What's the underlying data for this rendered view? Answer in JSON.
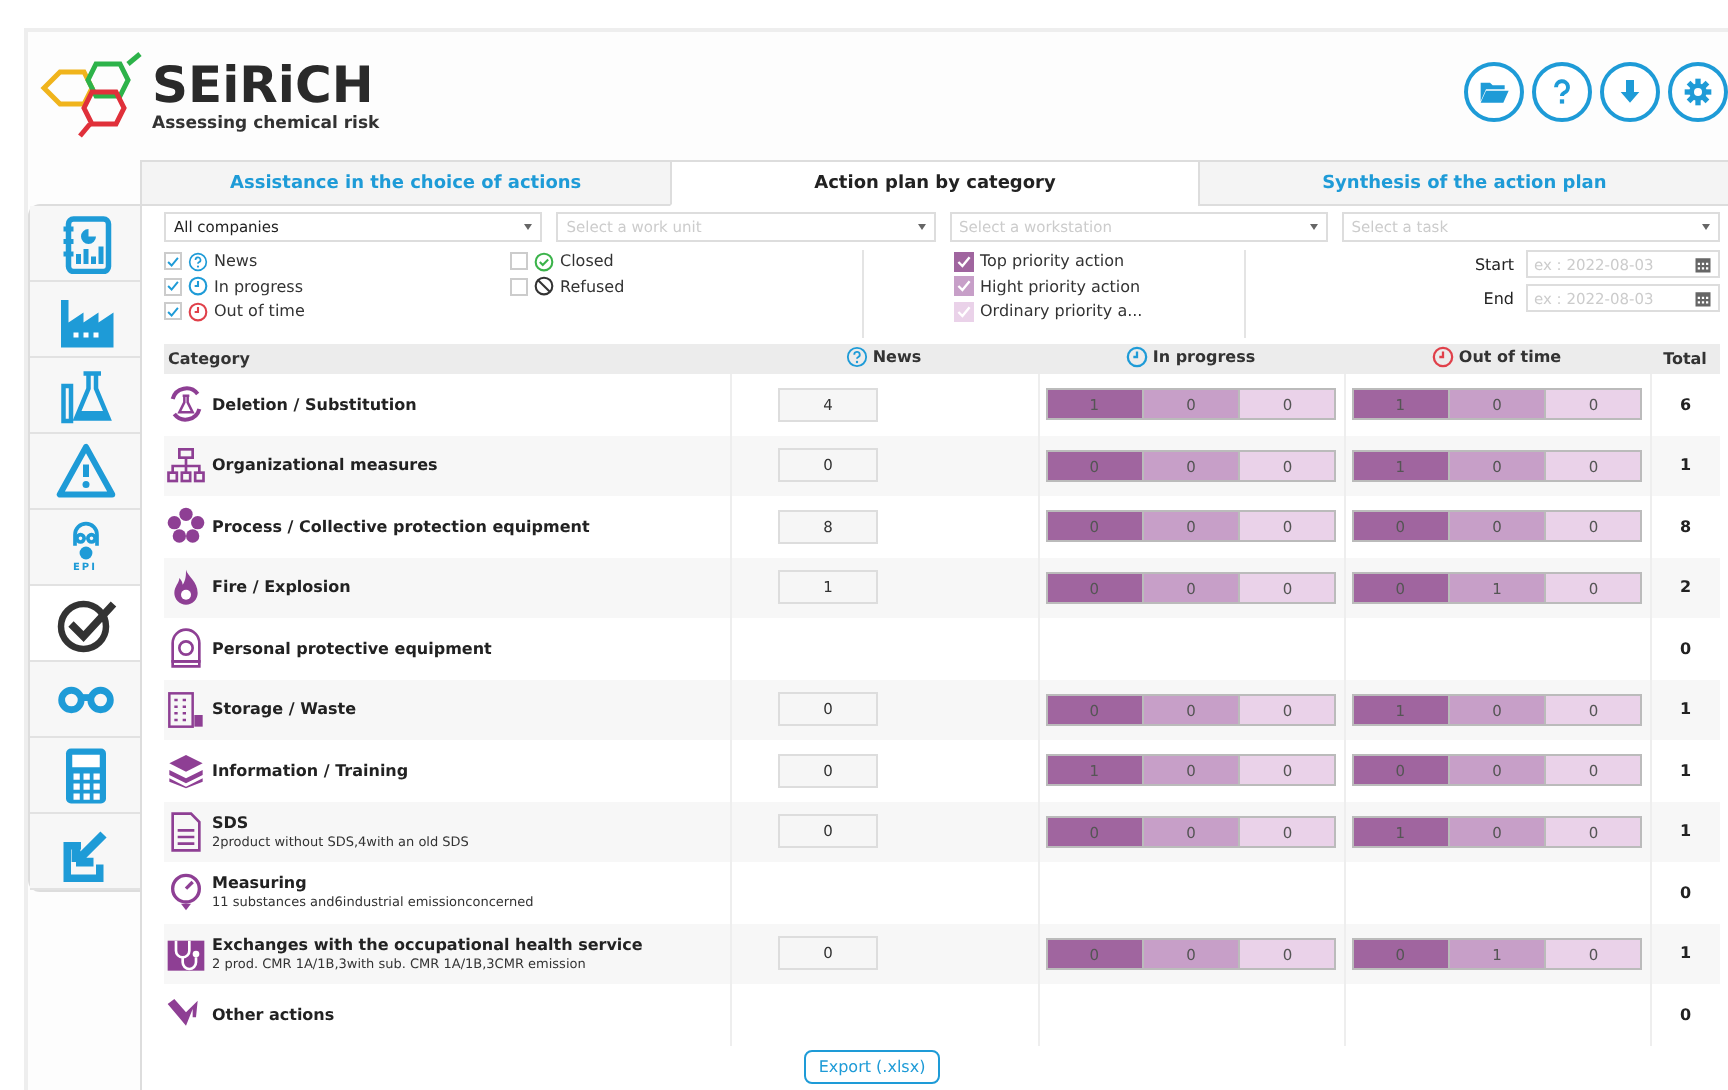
{
  "brand": {
    "name": "SEiRiCH",
    "tagline": "Assessing chemical risk"
  },
  "toolbar": [
    {
      "kind": "folder"
    },
    {
      "kind": "help"
    },
    {
      "kind": "download"
    },
    {
      "kind": "settings"
    }
  ],
  "sidebar": {
    "items": [
      {
        "kind": "report",
        "selected": false
      },
      {
        "kind": "factory",
        "selected": false
      },
      {
        "kind": "lab",
        "selected": false
      },
      {
        "kind": "warning",
        "selected": false
      },
      {
        "kind": "mask",
        "label": "EPI",
        "selected": false
      },
      {
        "kind": "check",
        "selected": true
      },
      {
        "kind": "binoculars",
        "selected": false
      },
      {
        "kind": "calculator",
        "selected": false
      },
      {
        "kind": "export",
        "selected": false
      }
    ]
  },
  "tabs": [
    {
      "label": "Assistance in the choice of actions",
      "selected": false
    },
    {
      "label": "Action plan by category",
      "selected": true
    },
    {
      "label": "Synthesis of the action plan",
      "selected": false
    }
  ],
  "selects": [
    {
      "value": "All companies"
    },
    {
      "placeholder": "Select a work unit"
    },
    {
      "placeholder": "Select a workstation"
    },
    {
      "placeholder": "Select a task"
    }
  ],
  "status_filters": [
    {
      "kind": "news",
      "label": "News",
      "checked": true
    },
    {
      "kind": "progress",
      "label": "In progress",
      "checked": true
    },
    {
      "kind": "late",
      "label": "Out of time",
      "checked": true
    },
    {
      "kind": "closed",
      "label": "Closed",
      "checked": false
    },
    {
      "kind": "refused",
      "label": "Refused",
      "checked": false
    }
  ],
  "priority_filters": [
    {
      "label": "Top priority action",
      "checked": true,
      "color": "#a0659f"
    },
    {
      "label": "Hight priority action",
      "checked": true,
      "color": "#c79fc8"
    },
    {
      "label": "Ordinary priority a...",
      "checked": true,
      "color": "#ead2e9"
    }
  ],
  "dates": [
    {
      "label": "Start",
      "placeholder": "ex : 2022-08-03"
    },
    {
      "label": "End",
      "placeholder": "ex : 2022-08-03"
    }
  ],
  "table": {
    "columns": [
      {
        "kind": "category",
        "label": "Category"
      },
      {
        "kind": "news",
        "label": "News"
      },
      {
        "kind": "progress",
        "label": "In progress"
      },
      {
        "kind": "late",
        "label": "Out of time"
      },
      {
        "kind": "total",
        "label": "Total"
      }
    ],
    "rows": [
      {
        "kind": "substitution",
        "name": "Deletion / Substitution",
        "news": "4",
        "in_progress": [
          "1",
          "0",
          "0"
        ],
        "out_of_time": [
          "1",
          "0",
          "0"
        ],
        "total": "6"
      },
      {
        "kind": "organization",
        "name": "Organizational measures",
        "news": "0",
        "in_progress": [
          "0",
          "0",
          "0"
        ],
        "out_of_time": [
          "1",
          "0",
          "0"
        ],
        "total": "1"
      },
      {
        "kind": "process",
        "name": "Process / Collective protection equipment",
        "news": "8",
        "in_progress": [
          "0",
          "0",
          "0"
        ],
        "out_of_time": [
          "0",
          "0",
          "0"
        ],
        "total": "8"
      },
      {
        "kind": "fire",
        "name": "Fire / Explosion",
        "news": "1",
        "in_progress": [
          "0",
          "0",
          "0"
        ],
        "out_of_time": [
          "0",
          "1",
          "0"
        ],
        "total": "2"
      },
      {
        "kind": "ppe",
        "name": "Personal protective equipment",
        "total": "0"
      },
      {
        "kind": "storage",
        "name": "Storage / Waste",
        "news": "0",
        "in_progress": [
          "0",
          "0",
          "0"
        ],
        "out_of_time": [
          "1",
          "0",
          "0"
        ],
        "total": "1"
      },
      {
        "kind": "training",
        "name": "Information / Training",
        "news": "0",
        "in_progress": [
          "1",
          "0",
          "0"
        ],
        "out_of_time": [
          "0",
          "0",
          "0"
        ],
        "total": "1"
      },
      {
        "kind": "sds",
        "name": "SDS",
        "detail": "2product without SDS,4with an old SDS",
        "news": "0",
        "in_progress": [
          "0",
          "0",
          "0"
        ],
        "out_of_time": [
          "1",
          "0",
          "0"
        ],
        "total": "1"
      },
      {
        "kind": "measuring",
        "name": "Measuring",
        "detail": "11 substances and6industrial emissionconcerned",
        "total": "0"
      },
      {
        "kind": "health",
        "name": "Exchanges with the occupational health service",
        "detail": "2 prod. CMR 1A/1B,3with sub. CMR 1A/1B,3CMR emission",
        "news": "0",
        "in_progress": [
          "0",
          "0",
          "0"
        ],
        "out_of_time": [
          "0",
          "1",
          "0"
        ],
        "total": "1"
      },
      {
        "kind": "other",
        "name": "Other actions",
        "total": "0"
      }
    ]
  },
  "export_button": "Export (.xlsx)"
}
